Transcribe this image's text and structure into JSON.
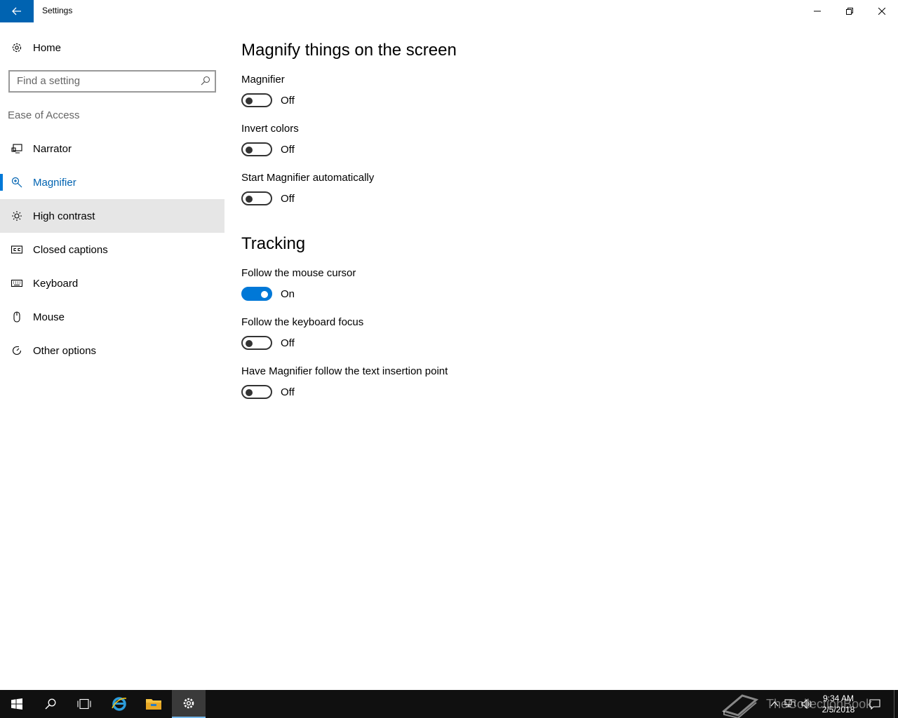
{
  "window": {
    "title": "Settings"
  },
  "sidebar": {
    "home_label": "Home",
    "search_placeholder": "Find a setting",
    "section_label": "Ease of Access",
    "items": [
      {
        "label": "Narrator",
        "icon": "narrator-icon"
      },
      {
        "label": "Magnifier",
        "icon": "magnifier-icon",
        "selected": true
      },
      {
        "label": "High contrast",
        "icon": "brightness-icon",
        "hover": true
      },
      {
        "label": "Closed captions",
        "icon": "closed-captions-icon"
      },
      {
        "label": "Keyboard",
        "icon": "keyboard-icon"
      },
      {
        "label": "Mouse",
        "icon": "mouse-icon"
      },
      {
        "label": "Other options",
        "icon": "other-options-icon"
      }
    ]
  },
  "main": {
    "heading": "Magnify things on the screen",
    "settings": [
      {
        "label": "Magnifier",
        "state": "Off"
      },
      {
        "label": "Invert colors",
        "state": "Off"
      },
      {
        "label": "Start Magnifier automatically",
        "state": "Off"
      }
    ],
    "tracking_heading": "Tracking",
    "tracking": [
      {
        "label": "Follow the mouse cursor",
        "state": "On"
      },
      {
        "label": "Follow the keyboard focus",
        "state": "Off"
      },
      {
        "label": "Have Magnifier follow the text insertion point",
        "state": "Off"
      }
    ]
  },
  "taskbar": {
    "time": "9:34 AM",
    "date": "2/5/2018",
    "watermark": "TheCollectionBook"
  },
  "colors": {
    "accent": "#0078d7",
    "selected_text": "#0063b1",
    "hover_bg": "#e6e6e6",
    "taskbar": "#101010"
  }
}
